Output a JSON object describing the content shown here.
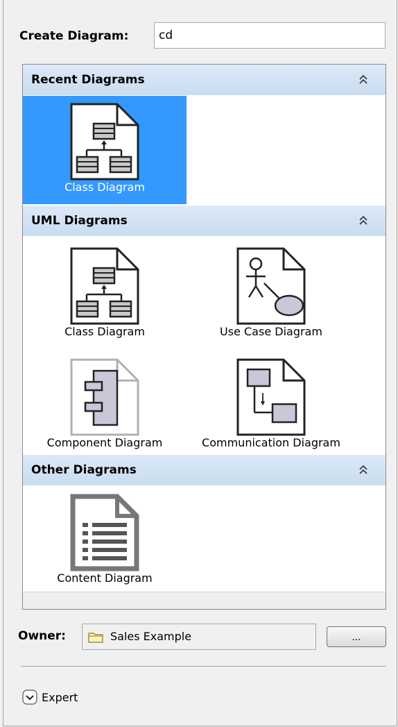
{
  "create": {
    "label": "Create Diagram:",
    "value": "cd"
  },
  "sections": {
    "recent": {
      "title": "Recent Diagrams",
      "items": [
        {
          "label": "Class Diagram",
          "icon": "class-diagram-icon",
          "selected": true
        }
      ]
    },
    "uml": {
      "title": "UML Diagrams",
      "items": [
        {
          "label": "Class Diagram",
          "icon": "class-diagram-icon"
        },
        {
          "label": "Use Case Diagram",
          "icon": "use-case-diagram-icon"
        },
        {
          "label": "Component Diagram",
          "icon": "component-diagram-icon"
        },
        {
          "label": "Communication Diagram",
          "icon": "communication-diagram-icon"
        }
      ]
    },
    "other": {
      "title": "Other Diagrams",
      "items": [
        {
          "label": "Content Diagram",
          "icon": "content-diagram-icon"
        }
      ]
    }
  },
  "owner": {
    "label": "Owner:",
    "value": "Sales Example",
    "browse_label": "..."
  },
  "expert": {
    "label": "Expert"
  },
  "colors": {
    "selection": "#3399ff",
    "section_header": "#d2e2f4"
  }
}
